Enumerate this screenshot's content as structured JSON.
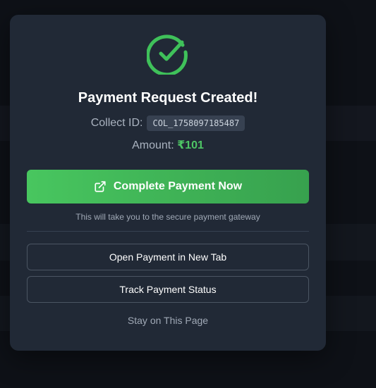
{
  "modal": {
    "title": "Payment Request Created!",
    "collect_label": "Collect ID:",
    "collect_id": "COL_1758097185487",
    "amount_label": "Amount:",
    "amount_value": "₹101",
    "primary_button": "Complete Payment Now",
    "hint": "This will take you to the secure payment gateway",
    "open_tab_button": "Open Payment in New Tab",
    "track_button": "Track Payment Status",
    "stay_link": "Stay on This Page"
  },
  "icons": {
    "success": "check-circle-icon",
    "external": "external-link-icon"
  },
  "colors": {
    "success_green": "#4ec565",
    "button_green": "#48c65f",
    "modal_bg": "#212936",
    "page_bg": "#12161d"
  }
}
